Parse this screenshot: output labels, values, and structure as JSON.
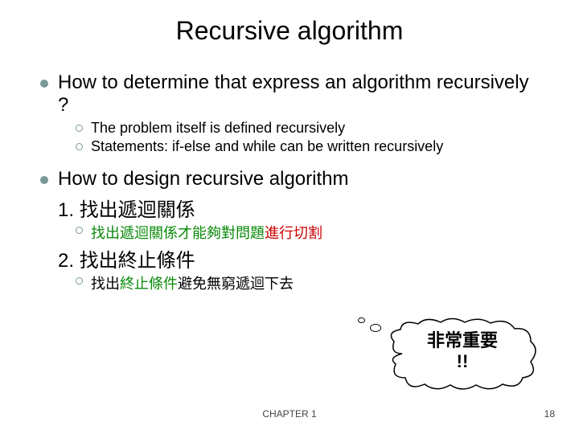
{
  "title": "Recursive algorithm",
  "point1": {
    "text": "How to determine that express an algorithm recursively ?",
    "sub1": "The problem itself is defined recursively",
    "sub2": "Statements: if-else and while can be written recursively"
  },
  "point2": {
    "text": "How to design recursive algorithm",
    "step1_prefix": "1. ",
    "step1": "找出遞迴關係",
    "step1_sub_a": "找出遞迴關係才能夠對問題",
    "step1_sub_b": "進行切割",
    "step2_prefix": "2. ",
    "step2": "找出終止條件",
    "step2_sub_a": "找出",
    "step2_sub_b": "終止條件",
    "step2_sub_c": "避免無窮遞迴下去"
  },
  "callout": {
    "line1": "非常重要",
    "line2": "!!"
  },
  "footer": {
    "center": "CHAPTER 1",
    "page": "18"
  }
}
